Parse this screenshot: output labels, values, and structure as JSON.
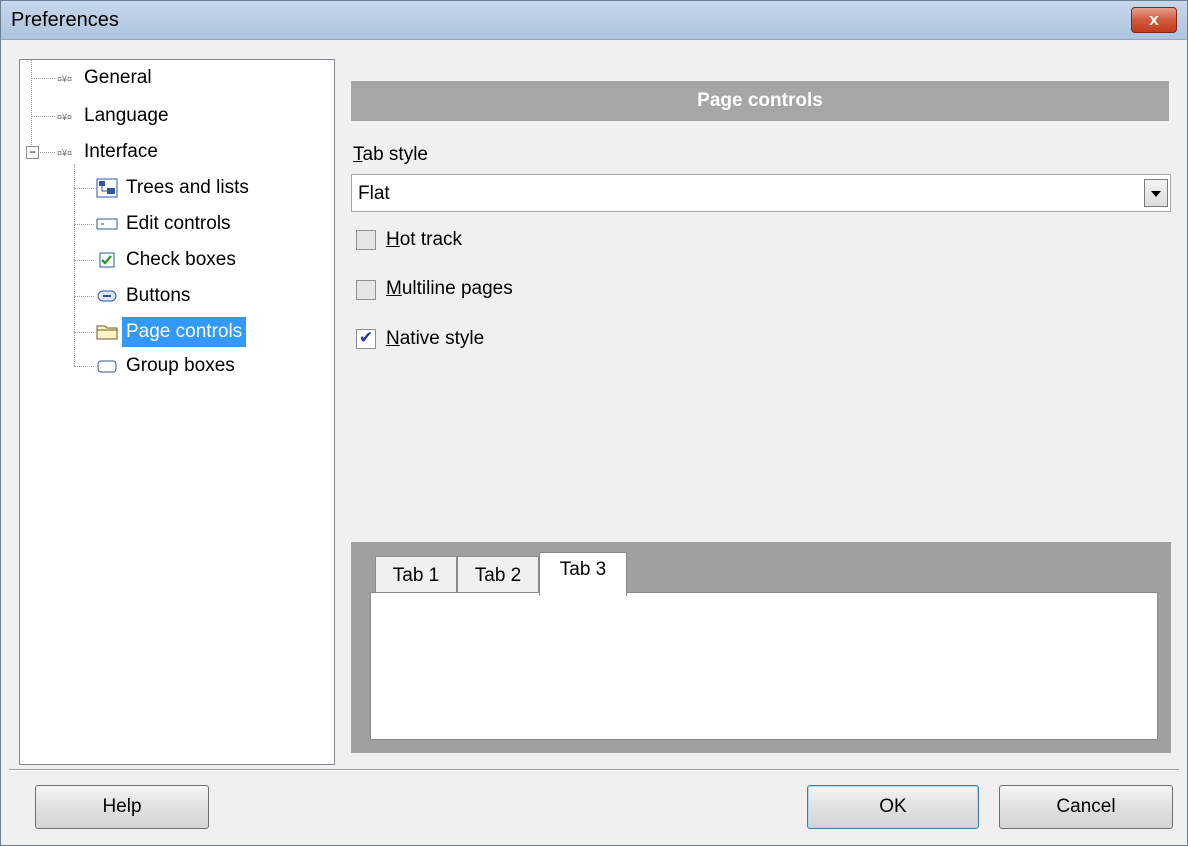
{
  "window": {
    "title": "Preferences",
    "close_label": "x"
  },
  "tree": {
    "items": [
      {
        "label": "General",
        "icon": "settings-icon"
      },
      {
        "label": "Language",
        "icon": "settings-icon"
      },
      {
        "label": "Interface",
        "icon": "settings-icon",
        "expanded": true
      },
      {
        "label": "Trees and lists",
        "icon": "tree-icon"
      },
      {
        "label": "Edit controls",
        "icon": "edit-control-icon"
      },
      {
        "label": "Check boxes",
        "icon": "checkbox-icon"
      },
      {
        "label": "Buttons",
        "icon": "button-icon"
      },
      {
        "label": "Page controls",
        "icon": "folder-tab-icon",
        "selected": true
      },
      {
        "label": "Group boxes",
        "icon": "group-box-icon"
      }
    ],
    "expander_symbol": "−"
  },
  "panel": {
    "header": "Page controls",
    "tab_style": {
      "label_hotkey": "T",
      "label_rest": "ab style",
      "value": "Flat"
    },
    "options": [
      {
        "hotkey": "H",
        "rest": "ot track",
        "checked": false
      },
      {
        "hotkey": "M",
        "rest": "ultiline pages",
        "checked": false
      },
      {
        "hotkey": "N",
        "rest": "ative style",
        "checked": true
      }
    ],
    "preview_tabs": [
      "Tab 1",
      "Tab 2",
      "Tab 3"
    ],
    "active_preview_tab": "Tab 3"
  },
  "footer": {
    "help": "Help",
    "ok": "OK",
    "cancel": "Cancel"
  }
}
